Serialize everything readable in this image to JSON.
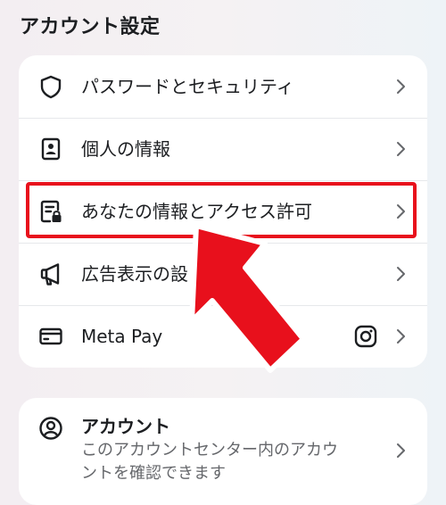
{
  "section_title": "アカウント設定",
  "items": [
    {
      "label": "パスワードとセキュリティ",
      "icon": "shield-icon"
    },
    {
      "label": "個人の情報",
      "icon": "id-card-icon"
    },
    {
      "label": "あなたの情報とアクセス許可",
      "icon": "document-lock-icon"
    },
    {
      "label": "広告表示の設",
      "icon": "megaphone-icon"
    },
    {
      "label": "Meta Pay",
      "icon": "credit-card-icon",
      "badge_icon": "instagram-icon"
    }
  ],
  "account": {
    "title": "アカウント",
    "description_line1": "このアカウントセンター内のアカウ",
    "description_line2": "ントを確認できます",
    "icon": "user-circle-icon"
  },
  "colors": {
    "highlight": "#e8101c",
    "arrow": "#e8101c",
    "text": "#1c1e21",
    "secondary_text": "#65676b"
  }
}
